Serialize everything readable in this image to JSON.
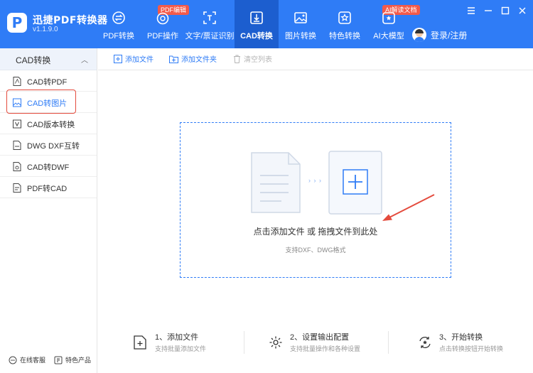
{
  "app": {
    "name": "迅捷PDF转换器",
    "version": "v1.1.9.0",
    "logo_letter": "P"
  },
  "nav": [
    {
      "label": "PDF转换",
      "icon": "convert-cycle-icon",
      "badge": ""
    },
    {
      "label": "PDF操作",
      "icon": "pdf-ops-icon",
      "badge": "PDF编辑"
    },
    {
      "label": "文字/票证识别",
      "icon": "ocr-scan-icon",
      "badge": ""
    },
    {
      "label": "CAD转换",
      "icon": "cad-download-icon",
      "badge": "",
      "active": true
    },
    {
      "label": "图片转换",
      "icon": "image-icon",
      "badge": ""
    },
    {
      "label": "特色转换",
      "icon": "star-convert-icon",
      "badge": ""
    },
    {
      "label": "AI大模型",
      "icon": "ai-model-icon",
      "badge": "AI解读文档"
    }
  ],
  "user": {
    "login_label": "登录/注册"
  },
  "sidebar": {
    "header": "CAD转换",
    "items": [
      {
        "label": "CAD转PDF",
        "icon": "pdf-file-icon"
      },
      {
        "label": "CAD转图片",
        "icon": "image-file-icon",
        "active": true
      },
      {
        "label": "CAD版本转换",
        "icon": "version-icon"
      },
      {
        "label": "DWG DXF互转",
        "icon": "dwg-file-icon"
      },
      {
        "label": "CAD转DWF",
        "icon": "dwf-file-icon"
      },
      {
        "label": "PDF转CAD",
        "icon": "pdf-cad-icon"
      }
    ],
    "footer": {
      "service": "在线客服",
      "products": "特色产品"
    }
  },
  "toolbar": {
    "add_file": "添加文件",
    "add_folder": "添加文件夹",
    "clear_list": "清空列表"
  },
  "dropzone": {
    "title": "点击添加文件 或 拖拽文件到此处",
    "subtitle": "支持DXF、DWG格式",
    "arrows": "› › ›"
  },
  "steps": [
    {
      "title": "1、添加文件",
      "desc": "支持批量添加文件"
    },
    {
      "title": "2、设置输出配置",
      "desc": "支持批量操作和各种设置"
    },
    {
      "title": "3、开始转换",
      "desc": "点击转换按钮开始转换"
    }
  ],
  "colors": {
    "primary": "#2f7cf6",
    "active_nav": "#1c5ecf",
    "badge": "#f35a4a",
    "highlight": "#e44b3d"
  }
}
